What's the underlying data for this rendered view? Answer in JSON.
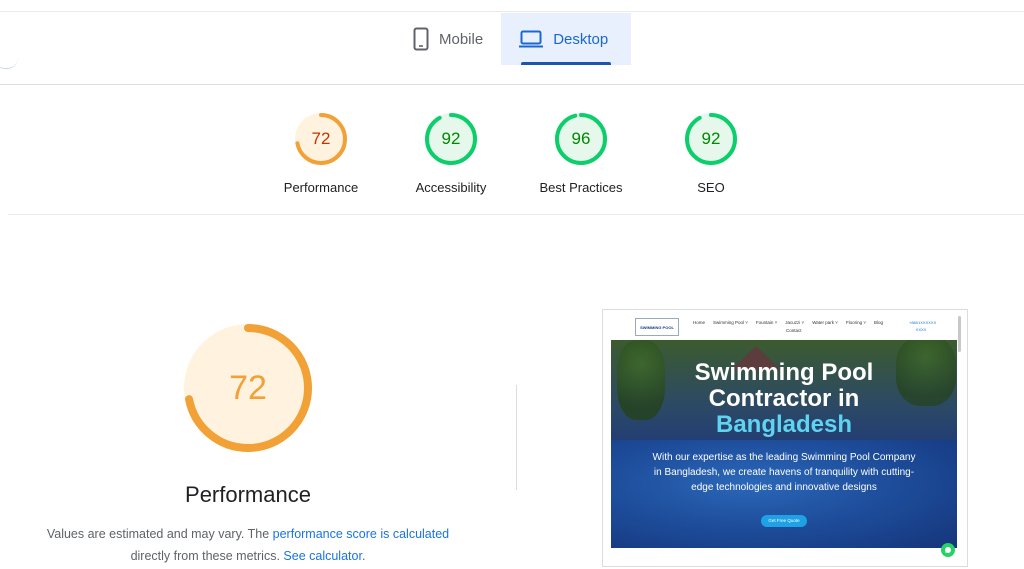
{
  "tabs": [
    {
      "label": "Mobile",
      "icon": "mobile-icon",
      "active": false
    },
    {
      "label": "Desktop",
      "icon": "desktop-icon",
      "active": true
    }
  ],
  "scores": [
    {
      "label": "Performance",
      "value": "72",
      "score": 72,
      "color": "#f2a136",
      "text_color": "#c33300",
      "fill": "#fff3e0"
    },
    {
      "label": "Accessibility",
      "value": "92",
      "score": 92,
      "color": "#0cce6b",
      "text_color": "#008800",
      "fill": "#e6f8ec"
    },
    {
      "label": "Best Practices",
      "value": "96",
      "score": 96,
      "color": "#0cce6b",
      "text_color": "#008800",
      "fill": "#e6f8ec"
    },
    {
      "label": "SEO",
      "value": "92",
      "score": 92,
      "color": "#0cce6b",
      "text_color": "#008800",
      "fill": "#e6f8ec"
    }
  ],
  "performance": {
    "score": 72,
    "value": "72",
    "title": "Performance",
    "desc_prefix": "Values are estimated and may vary. The ",
    "desc_link1": "performance score is calculated",
    "desc_mid": "directly from these metrics.",
    "desc_link2": "See calculator",
    "desc_suffix": "."
  },
  "screenshot": {
    "logo_text": "SWIMMING POOL",
    "menu": [
      "Home",
      "Swimming Pool ˅",
      "Fountain ˅",
      "Jacuzzi ˅",
      "Water park ˅",
      "Flooring ˅",
      "Blog"
    ],
    "menu_contact": "Contact",
    "phone": "+8801XXXXXX XXXX",
    "hero_title_line1": "Swimming Pool",
    "hero_title_line2": "Contractor in",
    "hero_title_line3": "Bangladesh",
    "hero_text": "With our expertise as the leading Swimming Pool Company in Bangladesh, we create havens of tranquility with cutting-edge technologies and innovative designs",
    "hero_button": "Get Free Quote"
  },
  "colors": {
    "accent": "#1a73e8",
    "average": "#f2a136",
    "pass": "#0cce6b"
  }
}
